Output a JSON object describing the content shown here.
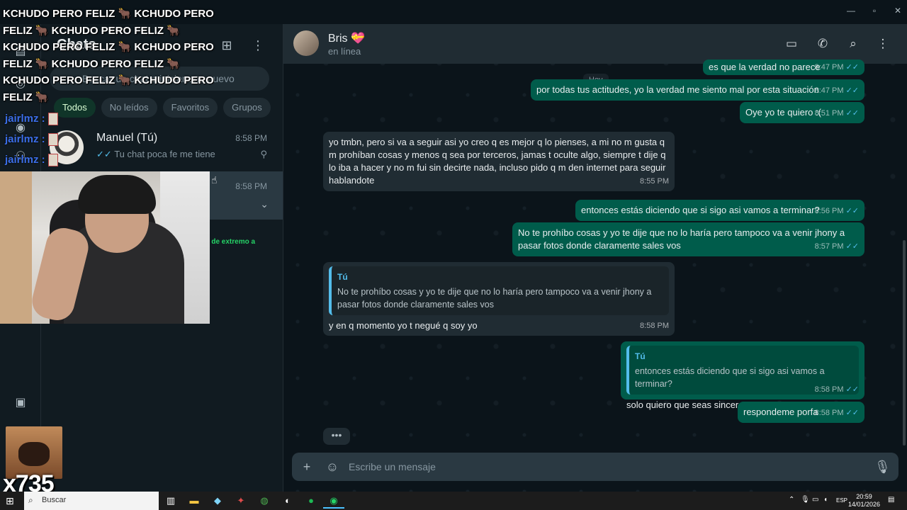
{
  "window": {
    "minimize": "—",
    "maximize": "▫",
    "close": "✕"
  },
  "rail": {
    "icons": [
      "chats-icon",
      "status-icon",
      "channels-icon",
      "communities-icon",
      "media-icon"
    ]
  },
  "list": {
    "title": "Chats",
    "new_chat_icon": "⊞",
    "menu_icon": "⋮",
    "search_placeholder": "Buscar un chat o iniciar uno nuevo",
    "filters": [
      "Todos",
      "No leídos",
      "Favoritos",
      "Grupos"
    ],
    "chats": [
      {
        "name": "Manuel (Tú)",
        "time": "8:58 PM",
        "last": "Tu chat poca fe me tiene",
        "tick": "✓✓"
      },
      {
        "name": "",
        "time": "8:58 PM",
        "last": ""
      }
    ],
    "green_snippet": "s de extremo a"
  },
  "conversation": {
    "contact_name": "Bris",
    "contact_emoji": "💝",
    "status": "en línea",
    "day_label": "Hoy",
    "messages": [
      {
        "dir": "out",
        "text": "es que la verdad no parece",
        "time": "8:47 PM"
      },
      {
        "dir": "out",
        "text": "por todas tus actitudes, yo la verdad me siento mal por esta situación",
        "time": "8:47 PM"
      },
      {
        "dir": "out",
        "text": "Oye yo te quiero :(",
        "time": "8:51 PM"
      },
      {
        "dir": "in",
        "text": "yo tmbn, pero si va a seguir asi yo creo q es mejor q lo pienses, a mi no m gusta q m prohíban cosas y menos q sea por terceros, jamas t oculte algo, siempre t dije q lo iba a hacer y no m fui sin decirte nada, incluso pido q m den internet para seguir hablandote",
        "time": "8:55 PM"
      },
      {
        "dir": "out",
        "text": "entonces estás diciendo que si sigo asi vamos a terminar?",
        "time": "8:56 PM"
      },
      {
        "dir": "out",
        "text": "No te prohíbo cosas y yo te dije que no lo haría pero tampoco va a venir jhony a pasar fotos donde claramente sales vos",
        "time": "8:57 PM"
      },
      {
        "dir": "in",
        "quote_author": "Tú",
        "quote_text": "No te prohíbo cosas y yo te dije que no lo haría pero tampoco va a venir jhony a pasar fotos donde claramente sales vos",
        "text": "y en q momento yo t negué q soy yo",
        "time": "8:58 PM"
      },
      {
        "dir": "out",
        "quote_author": "Tú",
        "quote_text": "entonces estás diciendo que si sigo asi vamos a terminar?",
        "text": "solo quiero que seas sincera con esta pregunta",
        "time": "8:58 PM"
      },
      {
        "dir": "out",
        "text": "respondeme porfa",
        "time": "8:58 PM"
      }
    ],
    "tick": "✓✓",
    "typing": "•••",
    "composer_placeholder": "Escribe un mensaje"
  },
  "overlay": {
    "banner_lines": [
      "KCHUDO PERO FELIZ 🐂 KCHUDO PERO",
      "FELIZ 🐂 KCHUDO PERO FELIZ 🐂",
      "KCHUDO PERO FELIZ 🐂 KCHUDO PERO",
      "FELIZ 🐂 KCHUDO PERO FELIZ 🐂",
      "KCHUDO PERO FELIZ 🐂 KCHUDO PERO",
      "FELIZ 🐂"
    ],
    "chat_users": [
      "jairlmz :",
      "jairlmz :",
      "jairlmz :"
    ],
    "emote_count": "x735"
  },
  "taskbar": {
    "search_label": "Buscar",
    "lang": "ESP",
    "time": "20:59",
    "date": "14/01/2026"
  },
  "colors": {
    "accent": "#00a884",
    "outgoing": "#005c4b",
    "incoming": "#202c33",
    "tick": "#53bdeb"
  }
}
